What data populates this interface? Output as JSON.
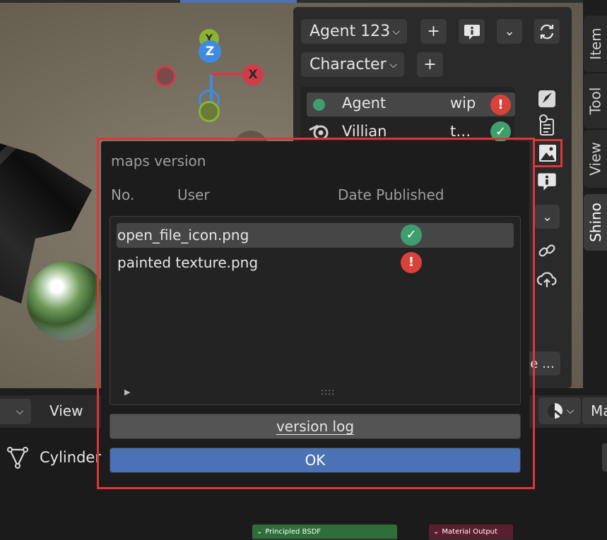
{
  "gizmo": {
    "x_label": "X",
    "y_label": "Y",
    "z_label": "Z"
  },
  "npanel": {
    "agent_dropdown": "Agent 123",
    "type_dropdown": "Character",
    "list": [
      {
        "name": "Agent",
        "status_text": "wip",
        "status": "error"
      },
      {
        "name": "Villian",
        "status_text": "t…",
        "status": "ok"
      }
    ],
    "more_label": "e …"
  },
  "side_tabs": [
    "Item",
    "Tool",
    "View",
    "Shino"
  ],
  "bottom_header": {
    "view_label": "View",
    "object_name": "Cylinder",
    "shading_partial": "Ma"
  },
  "nodes": {
    "principled": "Principled BSDF",
    "output": "Material Output"
  },
  "dialog": {
    "title": "maps version",
    "columns": {
      "no": "No.",
      "user": "User",
      "date": "Date Published"
    },
    "files": [
      {
        "name": "open_file_icon.png",
        "status": "ok"
      },
      {
        "name": "painted texture.png",
        "status": "error"
      }
    ],
    "resize_grip": "::::",
    "version_log_button": "version log",
    "ok_button": "OK"
  },
  "colors": {
    "accent_blue": "#4a72b4",
    "ok_green": "#3f9e6e",
    "error_red": "#d9423a",
    "highlight_red": "#e03535",
    "axis_x": "#d23b4a",
    "axis_y": "#8bb32f",
    "axis_z": "#3f8be2"
  }
}
